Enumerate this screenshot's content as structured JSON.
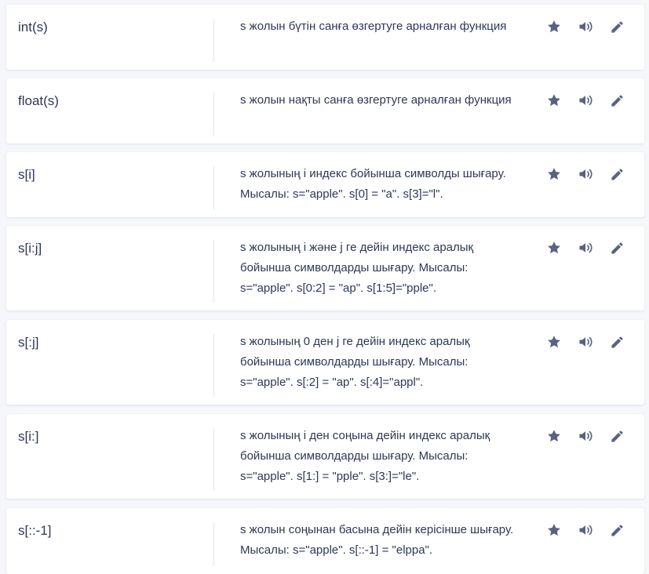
{
  "colors": {
    "background": "#f6f7fb",
    "card": "#ffffff",
    "text": "#2e3856",
    "icon": "#586380"
  },
  "icons": [
    "star-icon",
    "audio-icon",
    "pencil-icon"
  ],
  "terms": [
    {
      "term": "int(s)",
      "definition": "s жолын бүтін санға өзгертуге арналған функция"
    },
    {
      "term": "float(s)",
      "definition": "s жолын нақты санға өзгертуге арналған функция"
    },
    {
      "term": "s[i]",
      "definition": "s жолының i индекс бойынша символды шығару. Мысалы: s=\"apple\". s[0] = \"a\". s[3]=\"l\"."
    },
    {
      "term": "s[i:j]",
      "definition": "s жолының i және j ге дейін индекс аралық бойынша символдарды шығару. Мысалы: s=\"apple\". s[0:2] = \"ap\". s[1:5]=\"pple\"."
    },
    {
      "term": "s[:j]",
      "definition": "s жолының 0 ден j ге дейін индекс аралық бойынша символдарды шығару. Мысалы: s=\"apple\". s[:2] = \"ap\". s[:4]=\"appl\"."
    },
    {
      "term": "s[i:]",
      "definition": "s жолының i ден соңына дейін индекс аралық бойынша символдарды шығару. Мысалы: s=\"apple\". s[1:] = \"pple\". s[3:]=\"le\"."
    },
    {
      "term": "s[::-1]",
      "definition": "s жолын соңынан басына дейін керісінше шығару. Мысалы: s=\"apple\". s[::-1] = \"elppa\"."
    }
  ]
}
